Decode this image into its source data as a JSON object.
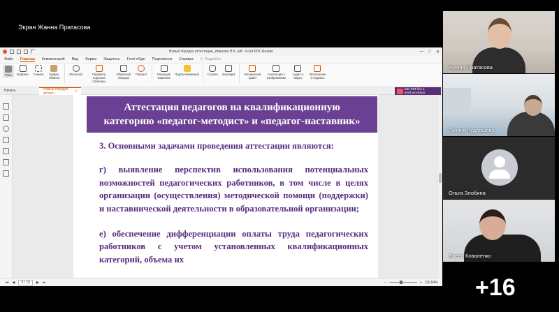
{
  "share_label": "Экран Жанна Пратасова",
  "window": {
    "title": "Новый порядок аттестации_Иванова Н.Б..pdf - Foxit PDF Reader",
    "controls": [
      "—",
      "□",
      "✕"
    ]
  },
  "menu": {
    "items": [
      "Файл",
      "Главная",
      "Комментарий",
      "Вид",
      "Форма",
      "Защитить",
      "Foxit eSign",
      "Поделиться",
      "Справка"
    ],
    "active": "Главная",
    "search_placeholder": "Подробно"
  },
  "ribbon": {
    "buttons": [
      {
        "label": "Рука",
        "icon": "hand-icon"
      },
      {
        "label": "Выбрать",
        "icon": "select-icon"
      },
      {
        "label": "Снимок",
        "icon": "snapshot-icon"
      },
      {
        "label": "Буфер обмена",
        "icon": "clipboard-icon"
      },
      {
        "label": "Масштаб",
        "icon": "zoom-icon"
      },
      {
        "label": "Параметр подгонка страницы",
        "icon": "fit-page-icon"
      },
      {
        "label": "Обратный порядок",
        "icon": "reverse-order-icon"
      },
      {
        "label": "Поворот",
        "icon": "rotate-icon"
      },
      {
        "label": "Пишущая машинка",
        "icon": "typewriter-icon"
      },
      {
        "label": "Подсвечиваемый",
        "icon": "highlight-icon"
      },
      {
        "label": "Ссылка",
        "icon": "link-icon"
      },
      {
        "label": "Закладка",
        "icon": "bookmark-icon"
      },
      {
        "label": "Вложенный файл",
        "icon": "attachment-icon"
      },
      {
        "label": "Аннотация к изображению",
        "icon": "image-annotation-icon"
      },
      {
        "label": "Аудио и видео",
        "icon": "audio-video-icon"
      },
      {
        "label": "Заполнение и подпись",
        "icon": "fill-sign-icon"
      }
    ]
  },
  "tabs": {
    "start": "Начать",
    "document": "Новый порядок аттест..."
  },
  "promo": {
    "line1": "Edit PDF like a",
    "line2": "word processor"
  },
  "slide": {
    "title_line1": "Аттестация педагогов на квалификационную",
    "title_line2": "категорию «педагог-методист» и «педагог-наставник»",
    "heading": "3. Основными задачами проведения аттестации являются:",
    "para_g": "г) выявление перспектив использования потенциальных возможностей педагогических работников, в том числе в целях организации (осуществления) методической помощи (поддержки) и наставнической деятельности в образовательной организации;",
    "para_e": "е) обеспечение дифференциации оплаты труда педагогических работников с учетом установленных квалификационных категорий, объема их"
  },
  "status": {
    "page": "3 / 15",
    "zoom": "110,54%",
    "zoom_fraction": 0.42
  },
  "participants": [
    {
      "name": "Жанна Пратасова"
    },
    {
      "name": "Галина Кудряшова"
    },
    {
      "name": "Ольга Злобина"
    },
    {
      "name": "Елена Коваленко"
    }
  ],
  "more_participants": "+16",
  "colors": {
    "accent": "#d35400",
    "slide_purple": "#6b3f93",
    "slide_text": "#5a2d80"
  }
}
